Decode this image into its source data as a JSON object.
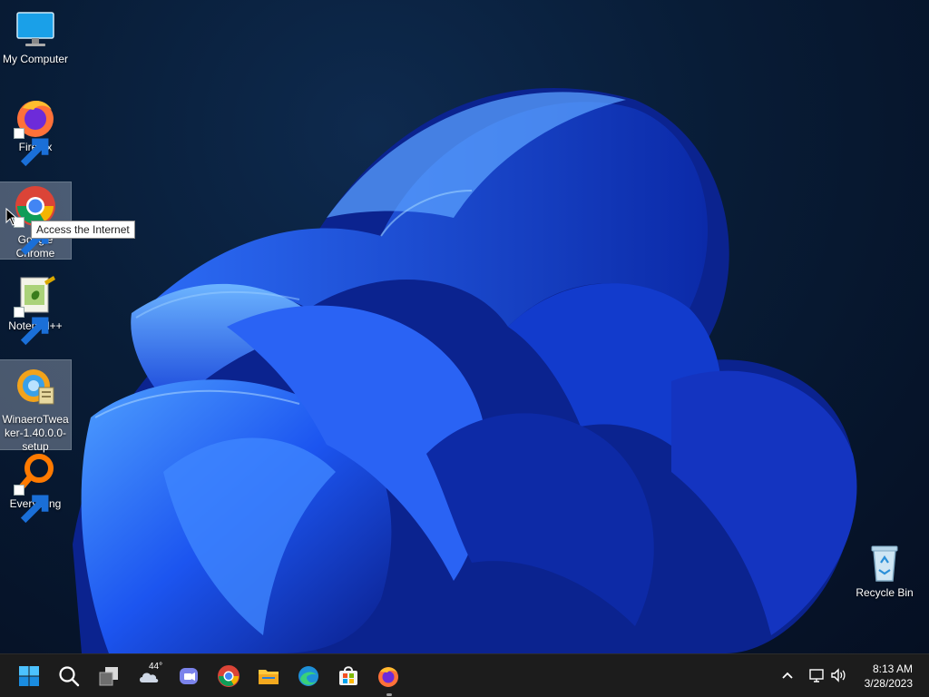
{
  "desktop": {
    "icons": [
      {
        "label": "My Computer",
        "icon": "monitor-icon"
      },
      {
        "label": "Firefox",
        "icon": "firefox-icon"
      },
      {
        "label": "Google Chrome",
        "icon": "chrome-icon"
      },
      {
        "label": "Notepad++",
        "icon": "notepadpp-icon"
      },
      {
        "label": "WinaeroTweaker-1.40.0.0-setup",
        "icon": "winaero-setup-icon"
      },
      {
        "label": "Everything",
        "icon": "everything-search-icon"
      },
      {
        "label": "Recycle Bin",
        "icon": "recycle-bin-icon"
      }
    ],
    "tooltip": "Access the Internet"
  },
  "taskbar": {
    "pinned": [
      "start-icon",
      "search-icon",
      "task-view-icon",
      "weather-widget-icon",
      "teams-chat-icon",
      "chrome-icon",
      "file-explorer-icon",
      "edge-icon",
      "store-icon",
      "firefox-icon"
    ],
    "weather_temp": "44°",
    "clock": {
      "time": "8:13 AM",
      "date": "3/28/2023"
    }
  },
  "colors": {
    "accent": "#1e6bff",
    "taskbar": "#1c1c1c",
    "wallpaper_bg": "#081c36"
  }
}
